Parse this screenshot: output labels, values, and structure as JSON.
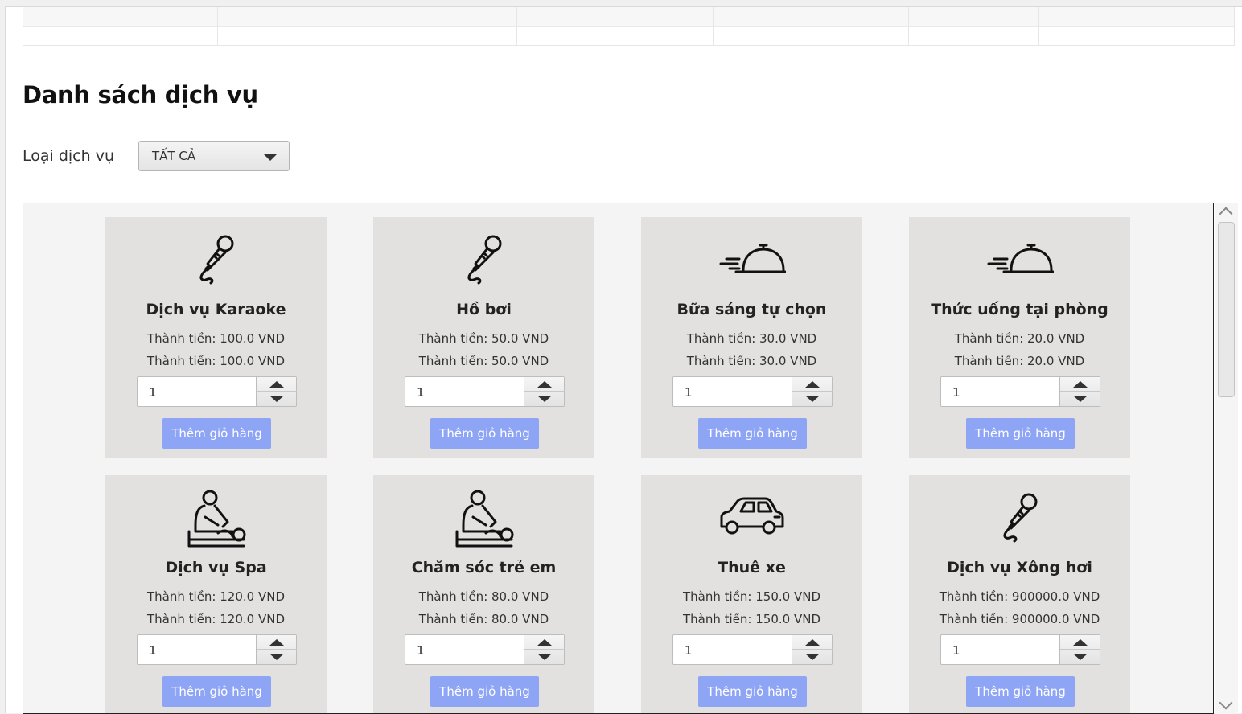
{
  "page": {
    "title": "Danh sách dịch vụ",
    "filter_label": "Loại dịch vụ",
    "filter_value": "TẤT CẢ"
  },
  "services": [
    {
      "name": "Dịch vụ Karaoke",
      "price1": "Thành tiền: 100.0 VND",
      "price2": "Thành tiền: 100.0 VND",
      "qty": "1",
      "button": "Thêm giỏ hàng",
      "icon": "microphone-icon"
    },
    {
      "name": "Hồ bơi",
      "price1": "Thành tiền: 50.0 VND",
      "price2": "Thành tiền: 50.0 VND",
      "qty": "1",
      "button": "Thêm giỏ hàng",
      "icon": "microphone-icon"
    },
    {
      "name": "Bữa sáng tự chọn",
      "price1": "Thành tiền: 30.0 VND",
      "price2": "Thành tiền: 30.0 VND",
      "qty": "1",
      "button": "Thêm giỏ hàng",
      "icon": "food-cloche-icon"
    },
    {
      "name": "Thức uống tại phòng",
      "price1": "Thành tiền: 20.0 VND",
      "price2": "Thành tiền: 20.0 VND",
      "qty": "1",
      "button": "Thêm giỏ hàng",
      "icon": "food-cloche-icon"
    },
    {
      "name": "Dịch vụ Spa",
      "price1": "Thành tiền: 120.0 VND",
      "price2": "Thành tiền: 120.0 VND",
      "qty": "1",
      "button": "Thêm giỏ hàng",
      "icon": "massage-icon"
    },
    {
      "name": "Chăm sóc trẻ em",
      "price1": "Thành tiền: 80.0 VND",
      "price2": "Thành tiền: 80.0 VND",
      "qty": "1",
      "button": "Thêm giỏ hàng",
      "icon": "massage-icon"
    },
    {
      "name": "Thuê xe",
      "price1": "Thành tiền: 150.0 VND",
      "price2": "Thành tiền: 150.0 VND",
      "qty": "1",
      "button": "Thêm giỏ hàng",
      "icon": "car-icon"
    },
    {
      "name": "Dịch vụ Xông hơi",
      "price1": "Thành tiền: 900000.0 VND",
      "price2": "Thành tiền: 900000.0 VND",
      "qty": "1",
      "button": "Thêm giỏ hàng",
      "icon": "microphone-icon"
    }
  ],
  "colors": {
    "card_bg": "#e3e0e0",
    "button_bg": "#8ea4f5",
    "panel_bg": "#f4f4f4"
  }
}
